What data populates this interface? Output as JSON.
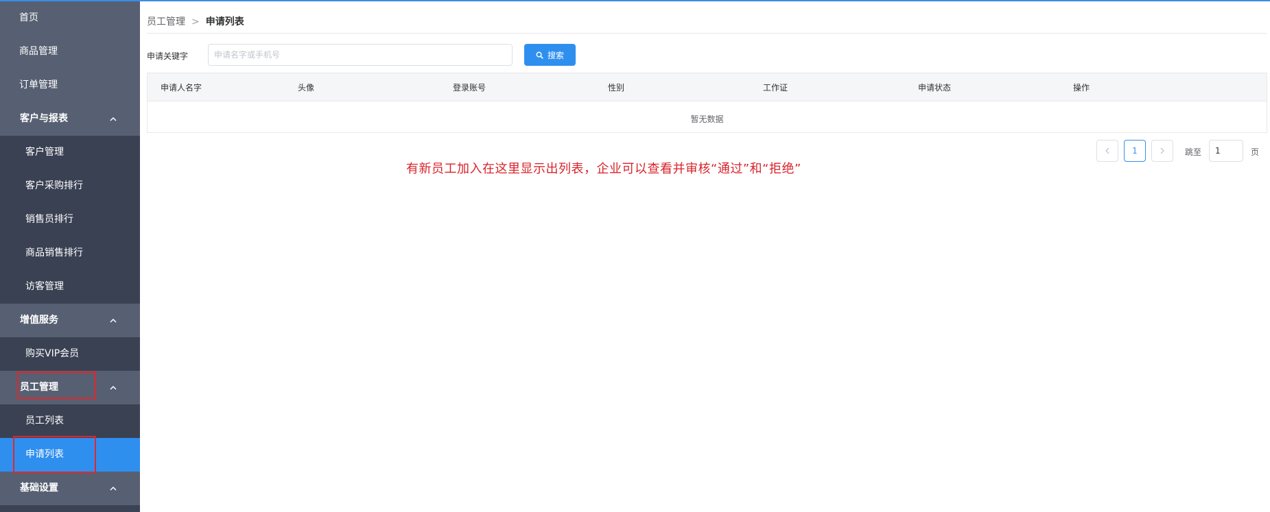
{
  "sidebar": {
    "items": [
      {
        "label": "首页"
      },
      {
        "label": "商品管理"
      },
      {
        "label": "订单管理"
      },
      {
        "label": "客户与报表"
      },
      {
        "label": "客户管理"
      },
      {
        "label": "客户采购排行"
      },
      {
        "label": "销售员排行"
      },
      {
        "label": "商品销售排行"
      },
      {
        "label": "访客管理"
      },
      {
        "label": "增值服务"
      },
      {
        "label": "购买VIP会员"
      },
      {
        "label": "员工管理"
      },
      {
        "label": "员工列表"
      },
      {
        "label": "申请列表"
      },
      {
        "label": "基础设置"
      }
    ]
  },
  "breadcrumb": {
    "parent": "员工管理",
    "separator": ">",
    "current": "申请列表"
  },
  "search": {
    "label": "申请关键字",
    "placeholder": "申请名字或手机号",
    "value": "",
    "button_label": "搜索"
  },
  "table": {
    "columns": [
      "申请人名字",
      "头像",
      "登录账号",
      "性别",
      "工作证",
      "申请状态",
      "操作"
    ],
    "empty_text": "暂无数据"
  },
  "pagination": {
    "current_page": "1",
    "jump_label": "跳至",
    "jump_value": "1",
    "page_suffix": "页"
  },
  "annotation": {
    "text": "有新员工加入在这里显示出列表，企业可以查看并审核“通过”和“拒绝”"
  },
  "colors": {
    "accent": "#2f8fef",
    "sidebar_bg": "#3b4254",
    "sidebar_group_bg": "#576072",
    "highlight_red": "#e3262a"
  }
}
